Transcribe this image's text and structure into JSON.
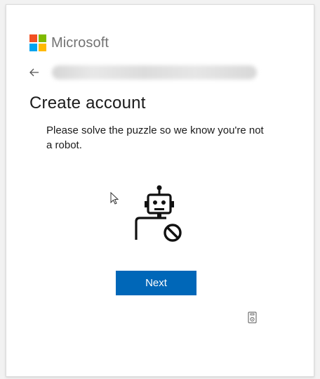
{
  "brand": {
    "name": "Microsoft",
    "logo_colors": [
      "#f25022",
      "#7fba00",
      "#00a4ef",
      "#ffb900"
    ]
  },
  "account": {
    "back_icon": "back-arrow-icon",
    "email": ""
  },
  "page": {
    "title": "Create account",
    "description": "Please solve the puzzle so we know you're not a robot."
  },
  "puzzle": {
    "icon": "robot-icon",
    "badge_icon": "blocked-icon"
  },
  "actions": {
    "next_label": "Next",
    "accent_color": "#0067b8"
  },
  "extras": {
    "audio_icon": "audio-challenge-icon",
    "cursor_icon": "mouse-cursor-icon"
  }
}
